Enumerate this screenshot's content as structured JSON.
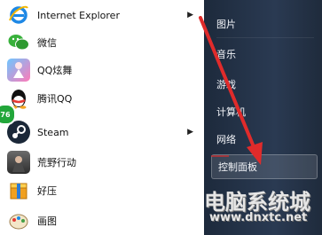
{
  "left_menu": [
    {
      "label": "Internet Explorer",
      "icon": "internet-explorer-icon",
      "has_arrow": true
    },
    {
      "label": "微信",
      "icon": "wechat-icon",
      "has_arrow": false
    },
    {
      "label": "QQ炫舞",
      "icon": "qq-dance-icon",
      "has_arrow": false
    },
    {
      "label": "腾讯QQ",
      "icon": "qq-icon",
      "has_arrow": false
    },
    {
      "label": "Steam",
      "icon": "steam-icon",
      "has_arrow": true
    },
    {
      "label": "荒野行动",
      "icon": "knives-out-icon",
      "has_arrow": false
    },
    {
      "label": "好压",
      "icon": "haozip-icon",
      "has_arrow": false
    },
    {
      "label": "画图",
      "icon": "paint-icon",
      "has_arrow": false
    }
  ],
  "badge_value": "76",
  "right_menu": {
    "pictures": "图片",
    "music": "音乐",
    "games": "游戏",
    "computer": "计算机",
    "network": "网络",
    "control_panel": "控制面板"
  },
  "watermark": {
    "line1": "电脑系统城",
    "line2": "www.dnxtc.net"
  },
  "colors": {
    "arrow": "#e02b2b",
    "right_panel": "#24324a"
  }
}
